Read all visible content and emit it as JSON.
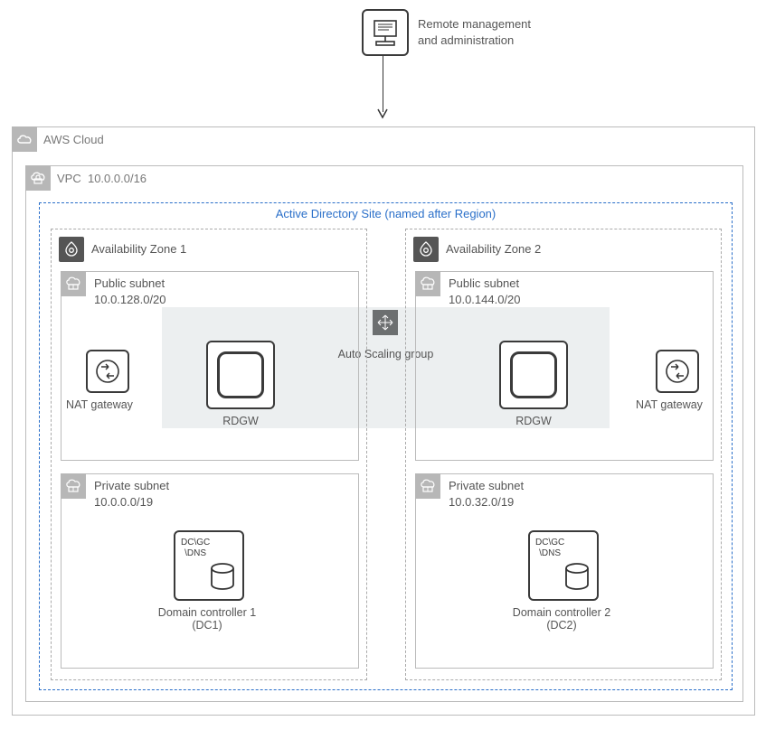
{
  "remote": {
    "title_l1": "Remote management",
    "title_l2": "and administration"
  },
  "cloud": {
    "label": "AWS Cloud"
  },
  "vpc": {
    "label": "VPC",
    "cidr": "10.0.0.0/16"
  },
  "adsite": {
    "title": "Active Directory Site (named after Region)"
  },
  "asg": {
    "label": "Auto Scaling group"
  },
  "az1": {
    "label": "Availability Zone 1",
    "public": {
      "title": "Public subnet",
      "cidr": "10.0.128.0/20",
      "nat": "NAT gateway",
      "rdgw": "RDGW"
    },
    "private": {
      "title": "Private subnet",
      "cidr": "10.0.0.0/19",
      "dc_label_l1": "Domain controller 1",
      "dc_label_l2": "(DC1)",
      "dc_text": "DC\\GC\n\\DNS"
    }
  },
  "az2": {
    "label": "Availability Zone 2",
    "public": {
      "title": "Public subnet",
      "cidr": "10.0.144.0/20",
      "nat": "NAT gateway",
      "rdgw": "RDGW"
    },
    "private": {
      "title": "Private subnet",
      "cidr": "10.0.32.0/19",
      "dc_label_l1": "Domain controller 2",
      "dc_label_l2": "(DC2)",
      "dc_text": "DC\\GC\n\\DNS"
    }
  }
}
